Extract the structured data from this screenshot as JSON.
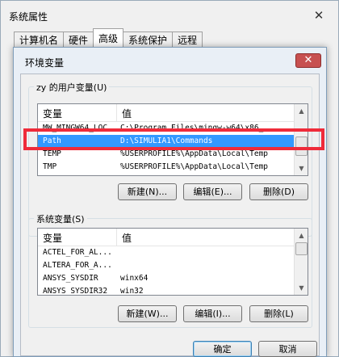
{
  "outer": {
    "title": "系统属性",
    "close_label": "✕",
    "tabs": [
      "计算机名",
      "硬件",
      "高级",
      "系统保护",
      "远程"
    ]
  },
  "dialog": {
    "title": "环境变量",
    "close_label": "✕",
    "user_group_label": "zy 的用户变量(U)",
    "sys_group_label": "系统变量(S)",
    "col_var": "变量",
    "col_val": "值",
    "user_vars": [
      {
        "name": "MW_MINGW64_LOC",
        "value": "C:\\Program Files\\mingw-w64\\x86_"
      },
      {
        "name": "Path",
        "value": "D:\\SIMULIA1\\Commands"
      },
      {
        "name": "TEMP",
        "value": "%USERPROFILE%\\AppData\\Local\\Temp"
      },
      {
        "name": "TMP",
        "value": "%USERPROFILE%\\AppData\\Local\\Temp"
      }
    ],
    "sys_vars": [
      {
        "name": "ACTEL_FOR_AL...",
        "value": ""
      },
      {
        "name": "ALTERA_FOR_A...",
        "value": ""
      },
      {
        "name": "ANSYS_SYSDIR",
        "value": "winx64"
      },
      {
        "name": "ANSYS_SYSDIR32",
        "value": "win32"
      }
    ],
    "user_buttons": {
      "new": "新建(N)...",
      "edit": "编辑(E)...",
      "delete": "删除(D)"
    },
    "sys_buttons": {
      "new": "新建(W)...",
      "edit": "编辑(I)...",
      "delete": "删除(L)"
    },
    "ok": "确定",
    "cancel": "取消"
  },
  "colors": {
    "selection": "#3399ff",
    "highlight_box": "#ef2b3a",
    "close": "#c75050"
  }
}
